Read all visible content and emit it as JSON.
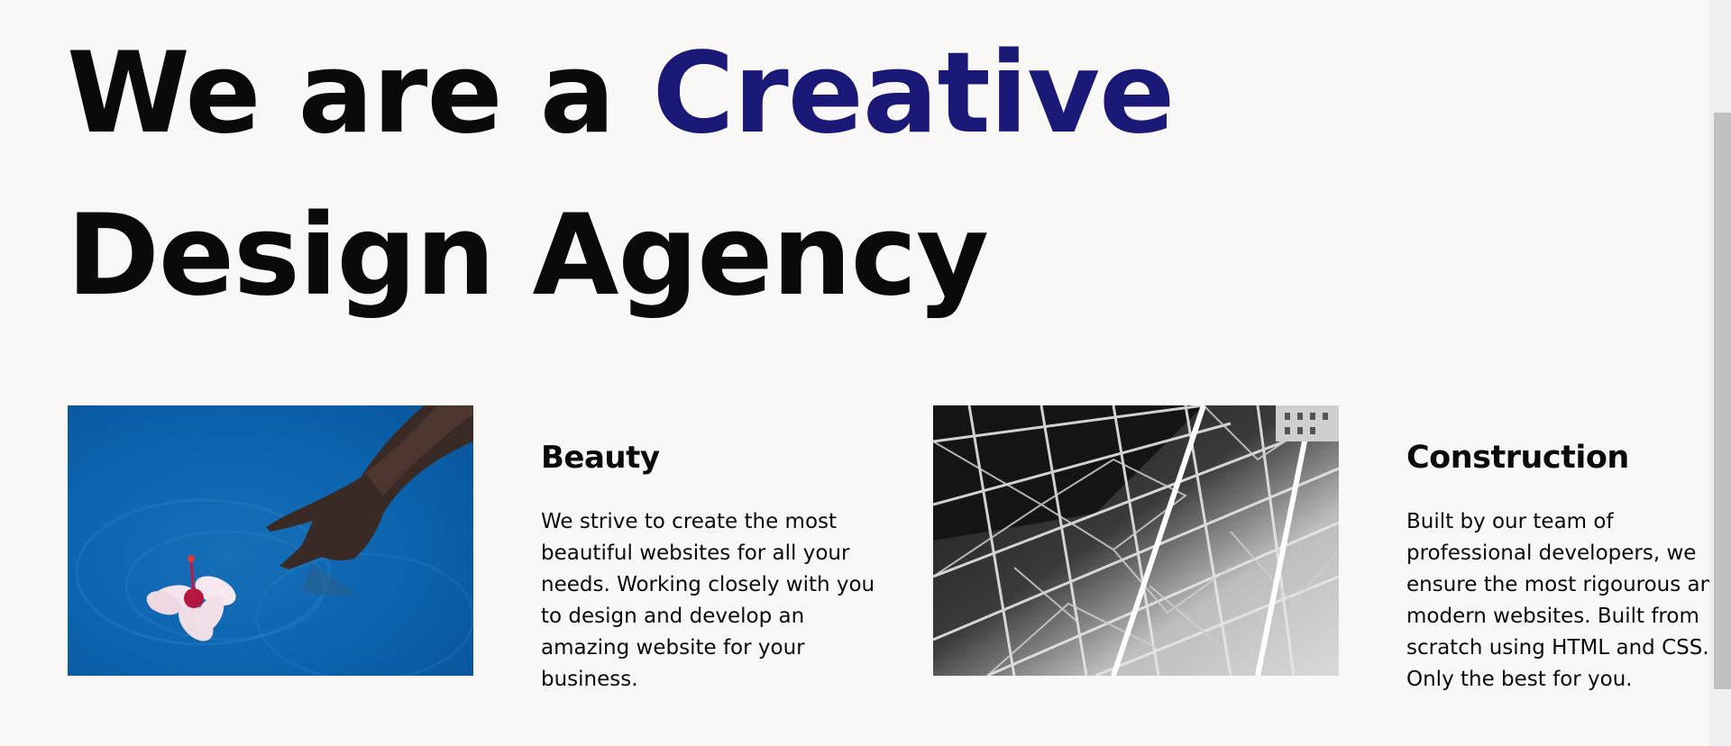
{
  "hero": {
    "line1_prefix": "We are a",
    "line1_accent": "Creative",
    "line2": "Design Agency",
    "accent_color": "#1a1978"
  },
  "services": [
    {
      "title": "Beauty",
      "text": "We strive to create the most beautiful websites for all your needs. Working closely with you to design and develop an amazing website for your business.",
      "image": "hand-touching-hibiscus-flower-in-pool"
    },
    {
      "title": "Construction",
      "text": "Built by our team of professional developers, we ensure the most rigourous and modern websites. Built from scratch using HTML and CSS. Only the best for you.",
      "image": "steel-truss-structure-black-and-white"
    }
  ]
}
